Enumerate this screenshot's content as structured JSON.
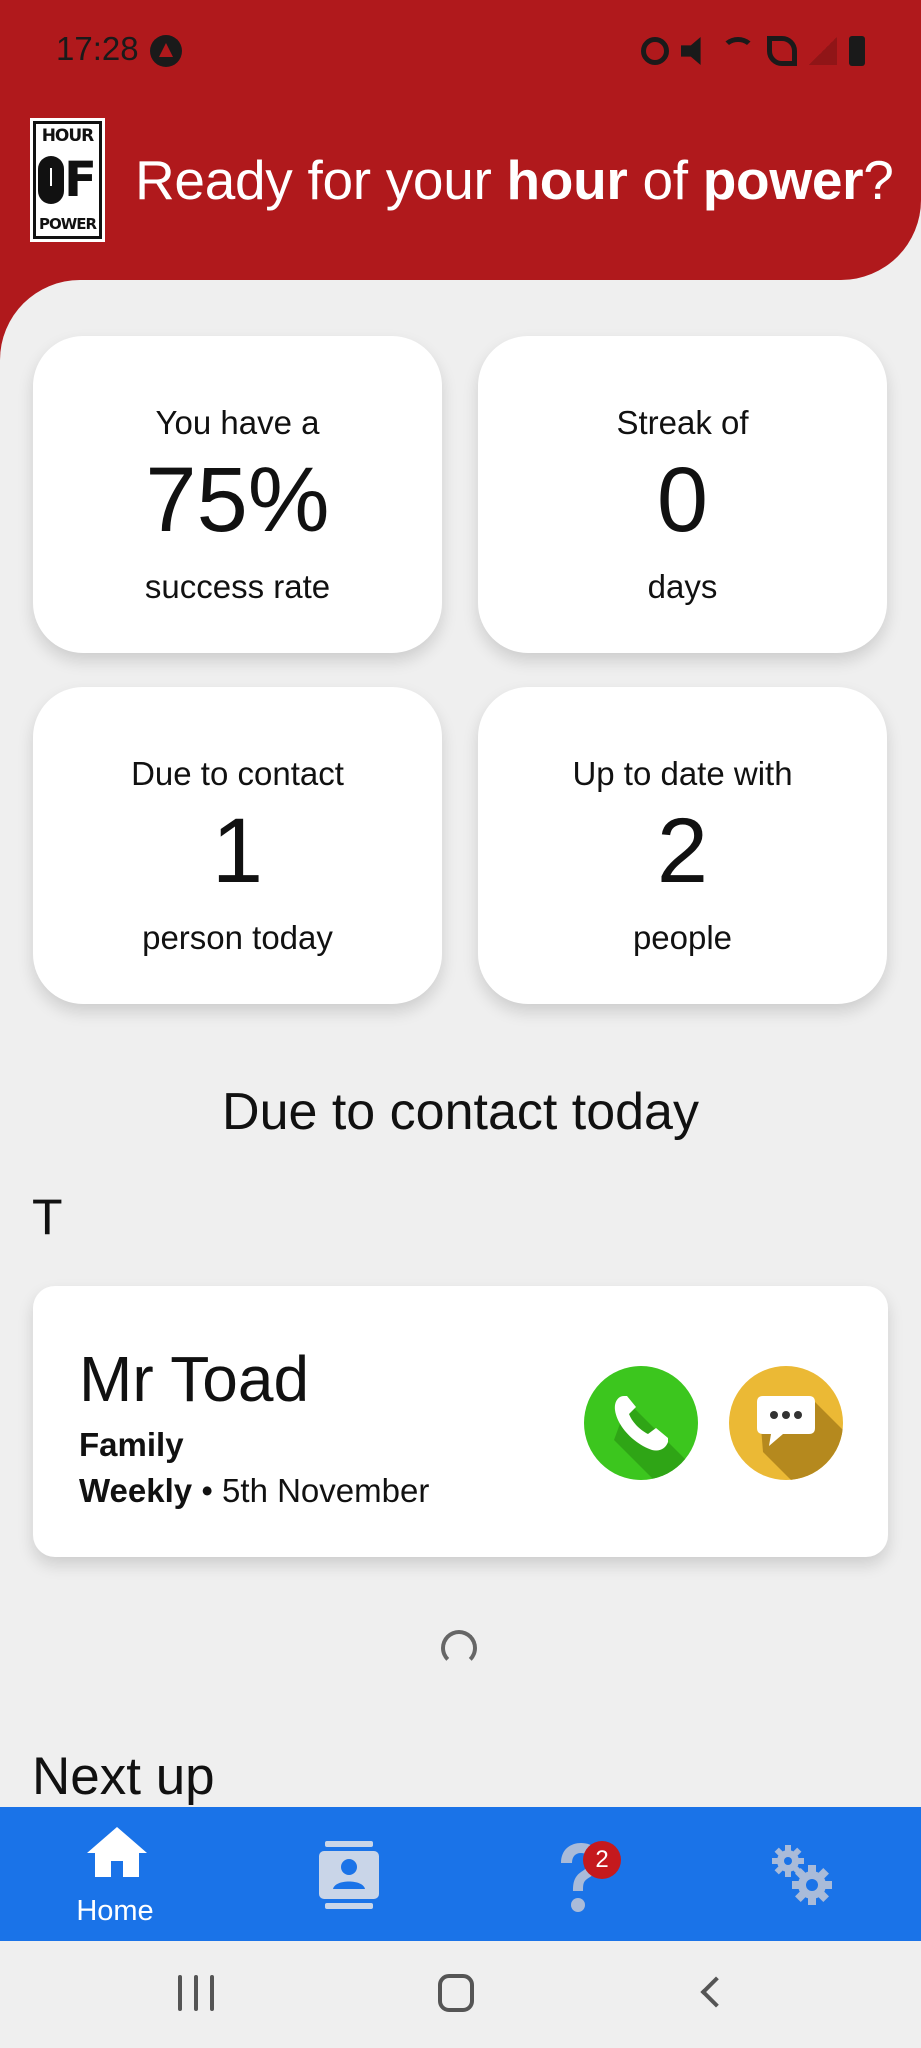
{
  "status_bar": {
    "time": "17:28",
    "icons": [
      "notification-icon",
      "alarm-icon",
      "mute-icon",
      "wifi-icon",
      "wifi-call-icon",
      "signal-icon",
      "battery-icon"
    ]
  },
  "header": {
    "logo": {
      "top": "HOUR",
      "middle": "F",
      "bottom": "POWER"
    },
    "title_parts": [
      "Ready for your ",
      "hour",
      " of ",
      "power",
      "?"
    ]
  },
  "stats": [
    {
      "top": "You have a",
      "value": "75%",
      "bottom": "success rate"
    },
    {
      "top": "Streak of",
      "value": "0",
      "bottom": "days"
    },
    {
      "top": "Due to contact",
      "value": "1",
      "bottom": "person today"
    },
    {
      "top": "Up to date with",
      "value": "2",
      "bottom": "people"
    }
  ],
  "due_section": {
    "title": "Due to contact today",
    "group_letter": "T",
    "contact": {
      "name": "Mr Toad",
      "group": "Family",
      "frequency": "Weekly",
      "separator": "•",
      "date": "5th November"
    }
  },
  "next_up": {
    "title": "Next up"
  },
  "bottom_nav": {
    "items": [
      {
        "label": "Home",
        "icon": "home-icon"
      },
      {
        "label": "",
        "icon": "contacts-icon"
      },
      {
        "label": "",
        "icon": "help-icon",
        "badge": "2"
      },
      {
        "label": "",
        "icon": "settings-icon"
      }
    ]
  },
  "colors": {
    "header": "#b0191c",
    "nav": "#1a73e8",
    "call_button": "#3cc61e",
    "message_button": "#ebb935",
    "background": "#efefef"
  }
}
